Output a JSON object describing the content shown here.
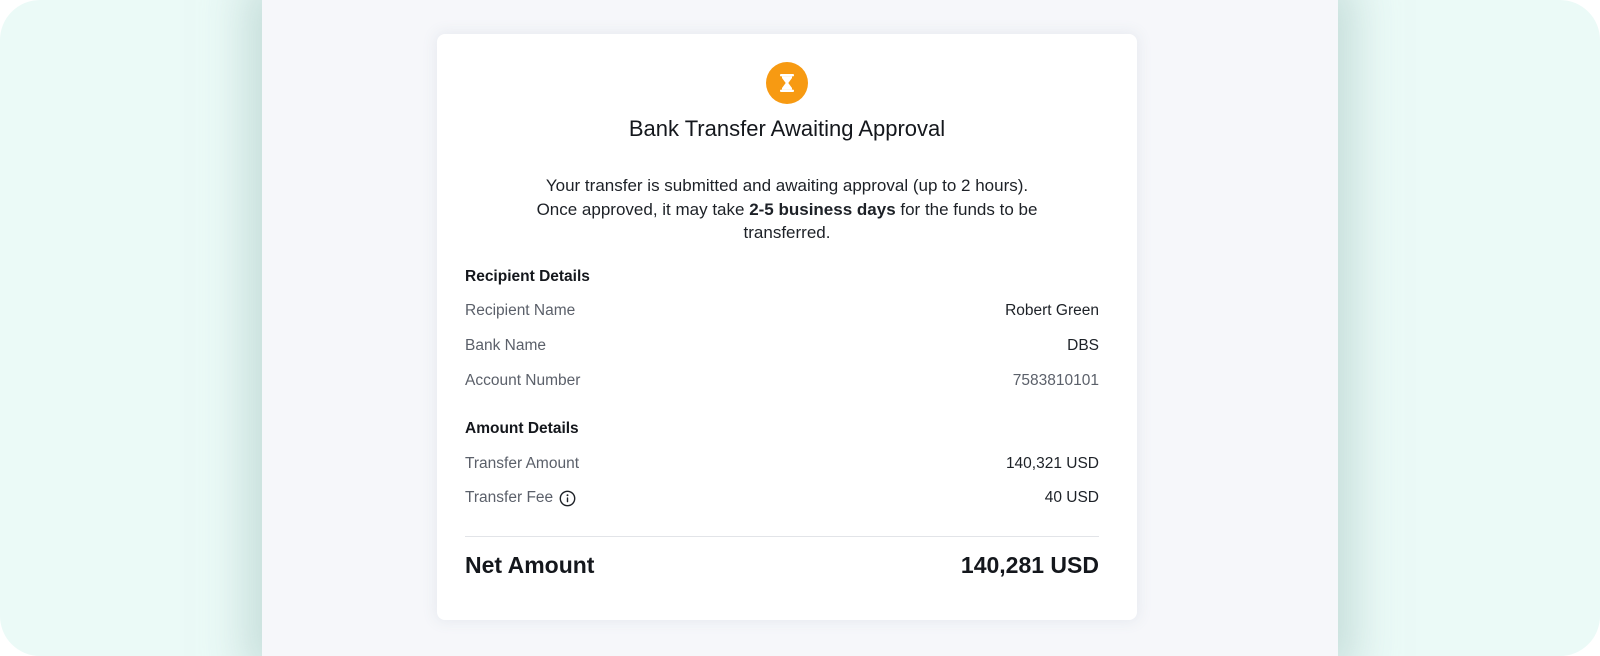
{
  "dialog": {
    "status_icon": "hourglass-icon",
    "title": "Bank Transfer Awaiting Approval",
    "description": {
      "line1": "Your transfer is submitted and awaiting approval (up to 2 hours).",
      "line2_prefix": "Once approved, it may take ",
      "line2_bold": "2-5 business days",
      "line2_suffix": " for the funds to be transferred."
    }
  },
  "recipient": {
    "section_title": "Recipient Details",
    "rows": [
      {
        "label": "Recipient Name",
        "value": "Robert Green"
      },
      {
        "label": "Bank Name",
        "value": "DBS"
      },
      {
        "label": "Account Number",
        "value": "7583810101"
      }
    ]
  },
  "amount": {
    "section_title": "Amount Details",
    "rows": [
      {
        "label": "Transfer Amount",
        "value": "140,321 USD"
      },
      {
        "label": "Transfer Fee",
        "value": "40 USD",
        "icon": "info-icon"
      }
    ]
  },
  "net": {
    "label": "Net Amount",
    "value": "140,281 USD"
  },
  "colors": {
    "accent": "#f79a12",
    "outer_background": "#ebfaf7",
    "panel_background": "#f6f7fa"
  }
}
